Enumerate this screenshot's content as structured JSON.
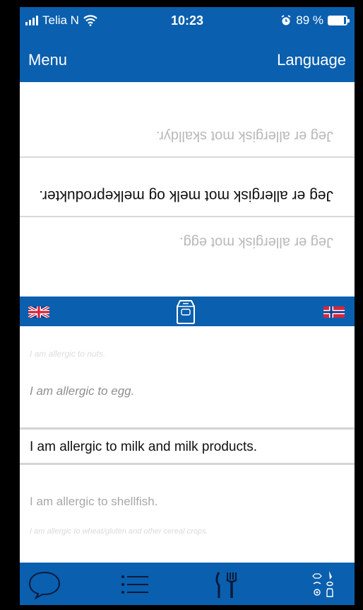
{
  "status_bar": {
    "carrier": "Telia N",
    "time": "10:23",
    "battery_percent": "89 %",
    "battery_level": 0.89
  },
  "nav": {
    "left_label": "Menu",
    "right_label": "Language"
  },
  "translated_phrases": [
    {
      "text": "Jeg er allergisk mot skalldyr."
    },
    {
      "text": "Jeg er allergisk mot melk og melkeprodukter."
    },
    {
      "text": "Jeg er allergisk mot egg."
    }
  ],
  "phrase_list": {
    "items": [
      "I am allergic to nuts.",
      "I am allergic to egg.",
      "I am allergic to milk and milk products.",
      "I am allergic to shellfish.",
      "I am allergic to wheat/gluten and other cereal crops."
    ],
    "selected_index": 2
  },
  "colors": {
    "brand_blue": "#0a5fae",
    "divider": "#d4d4d4"
  },
  "icons": {
    "source_flag": "uk-flag-icon",
    "target_flag": "norway-flag-icon",
    "category": "milk-carton-icon",
    "tabs": [
      "speech-bubble-icon",
      "list-icon",
      "fork-knife-icon",
      "allergen-symbols-icon"
    ]
  }
}
